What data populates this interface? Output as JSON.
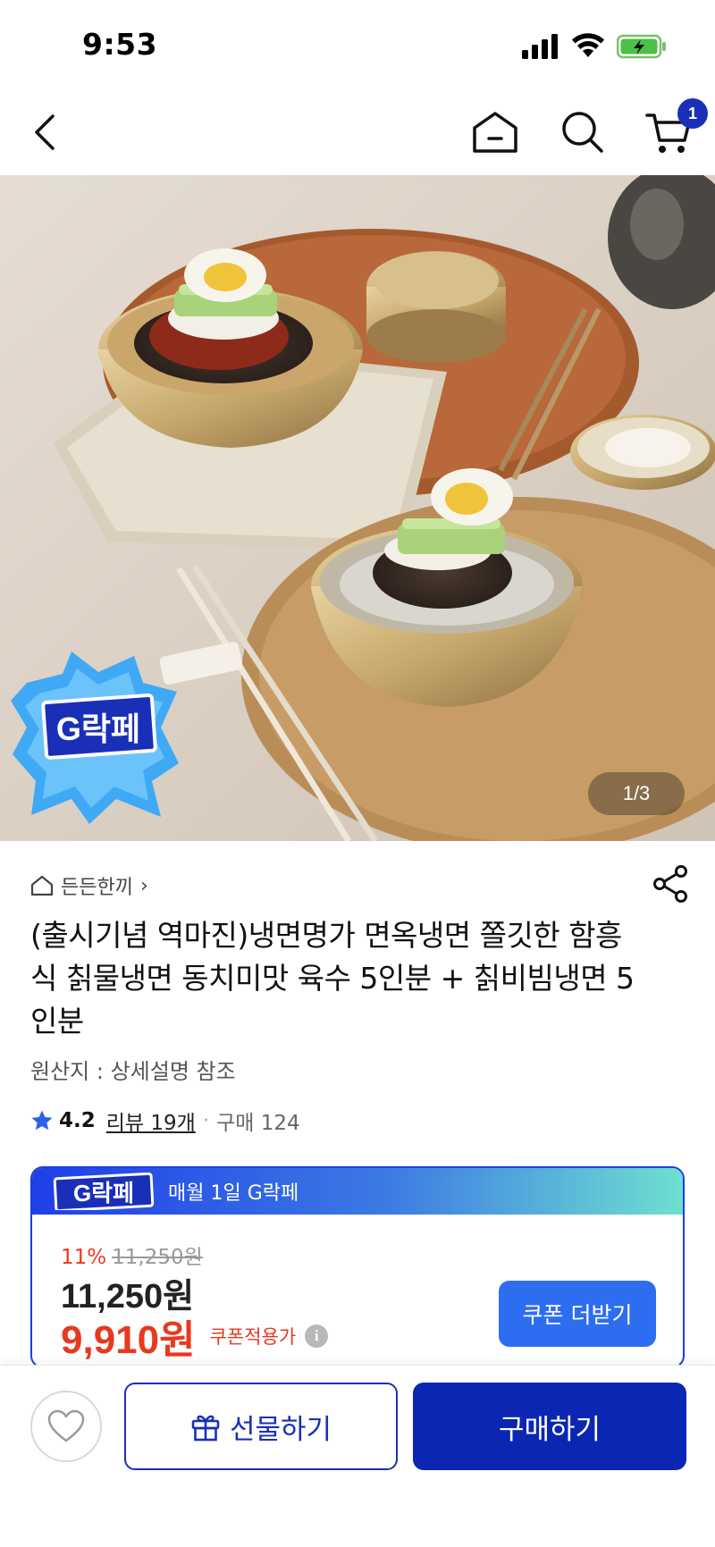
{
  "status_bar": {
    "time": "9:53"
  },
  "nav": {
    "cart_count": "1"
  },
  "hero": {
    "page_indicator": "1/3",
    "badge_text": "G락페"
  },
  "product": {
    "shop_name": "든든한끼",
    "shop_chevron": "›",
    "title": "(출시기념 역마진)냉면명가 면옥냉면 쫄깃한 함흥식 칡물냉면 동치미맛 육수 5인분 + 칡비빔냉면 5인분",
    "origin": "원산지 : 상세설명 참조",
    "rating": "4.2",
    "review_label": "리뷰 19개",
    "sep": "·",
    "purchase_label": "구매 124"
  },
  "price_card": {
    "header_text": "매월 1일 G락페",
    "discount_pct": "11%",
    "original_price": "11,250원",
    "price": "11,250원",
    "coupon_price": "9,910원",
    "coupon_label": "쿠폰적용가",
    "info_glyph": "i",
    "coupon_button": "쿠폰 더받기"
  },
  "bottom_bar": {
    "gift_label": "선물하기",
    "buy_label": "구매하기"
  },
  "colors": {
    "brand_blue": "#0b26b3",
    "accent_red": "#e8391f",
    "coupon_button": "#2d6df0"
  },
  "icons": [
    "back-arrow-icon",
    "home-icon",
    "search-icon",
    "cart-icon",
    "share-icon",
    "home-outline-icon",
    "star-icon",
    "info-icon",
    "gift-icon",
    "heart-icon"
  ]
}
